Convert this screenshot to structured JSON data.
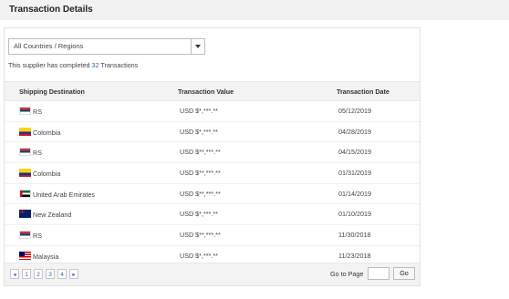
{
  "page": {
    "title": "Transaction Details"
  },
  "filter": {
    "selected": "All Countries / Regions"
  },
  "summary": {
    "prefix": "This supplier has completed",
    "count": "32",
    "suffix": "Transactions"
  },
  "table": {
    "headers": [
      "Shipping Destination",
      "Transaction Value",
      "Transaction Date"
    ],
    "rows": [
      {
        "flag": "rs-flag-icon",
        "destination": "RS",
        "value": "USD $*,***.**",
        "date": "05/12/2019"
      },
      {
        "flag": "colombia-flag-icon",
        "destination": "Colombia",
        "value": "USD $*,***.**",
        "date": "04/28/2019"
      },
      {
        "flag": "rs-flag-icon",
        "destination": "RS",
        "value": "USD $**,***.**",
        "date": "04/15/2019"
      },
      {
        "flag": "colombia-flag-icon",
        "destination": "Colombia",
        "value": "USD $**,***.**",
        "date": "01/31/2019"
      },
      {
        "flag": "uae-flag-icon",
        "destination": "United Arab Emirates",
        "value": "USD $**,***.**",
        "date": "01/14/2019"
      },
      {
        "flag": "nz-flag-icon",
        "destination": "New Zealand",
        "value": "USD $*,***.**",
        "date": "01/10/2019"
      },
      {
        "flag": "rs-flag-icon",
        "destination": "RS",
        "value": "USD $**,***.**",
        "date": "11/30/2018"
      },
      {
        "flag": "malaysia-flag-icon",
        "destination": "Malaysia",
        "value": "USD $*,***.**",
        "date": "11/23/2018"
      }
    ]
  },
  "pagination": {
    "prev": "◂",
    "pages": [
      "1",
      "2",
      "3",
      "4"
    ],
    "next": "▸",
    "goto_label": "Go to Page",
    "goto_value": "",
    "go_button": "Go"
  }
}
